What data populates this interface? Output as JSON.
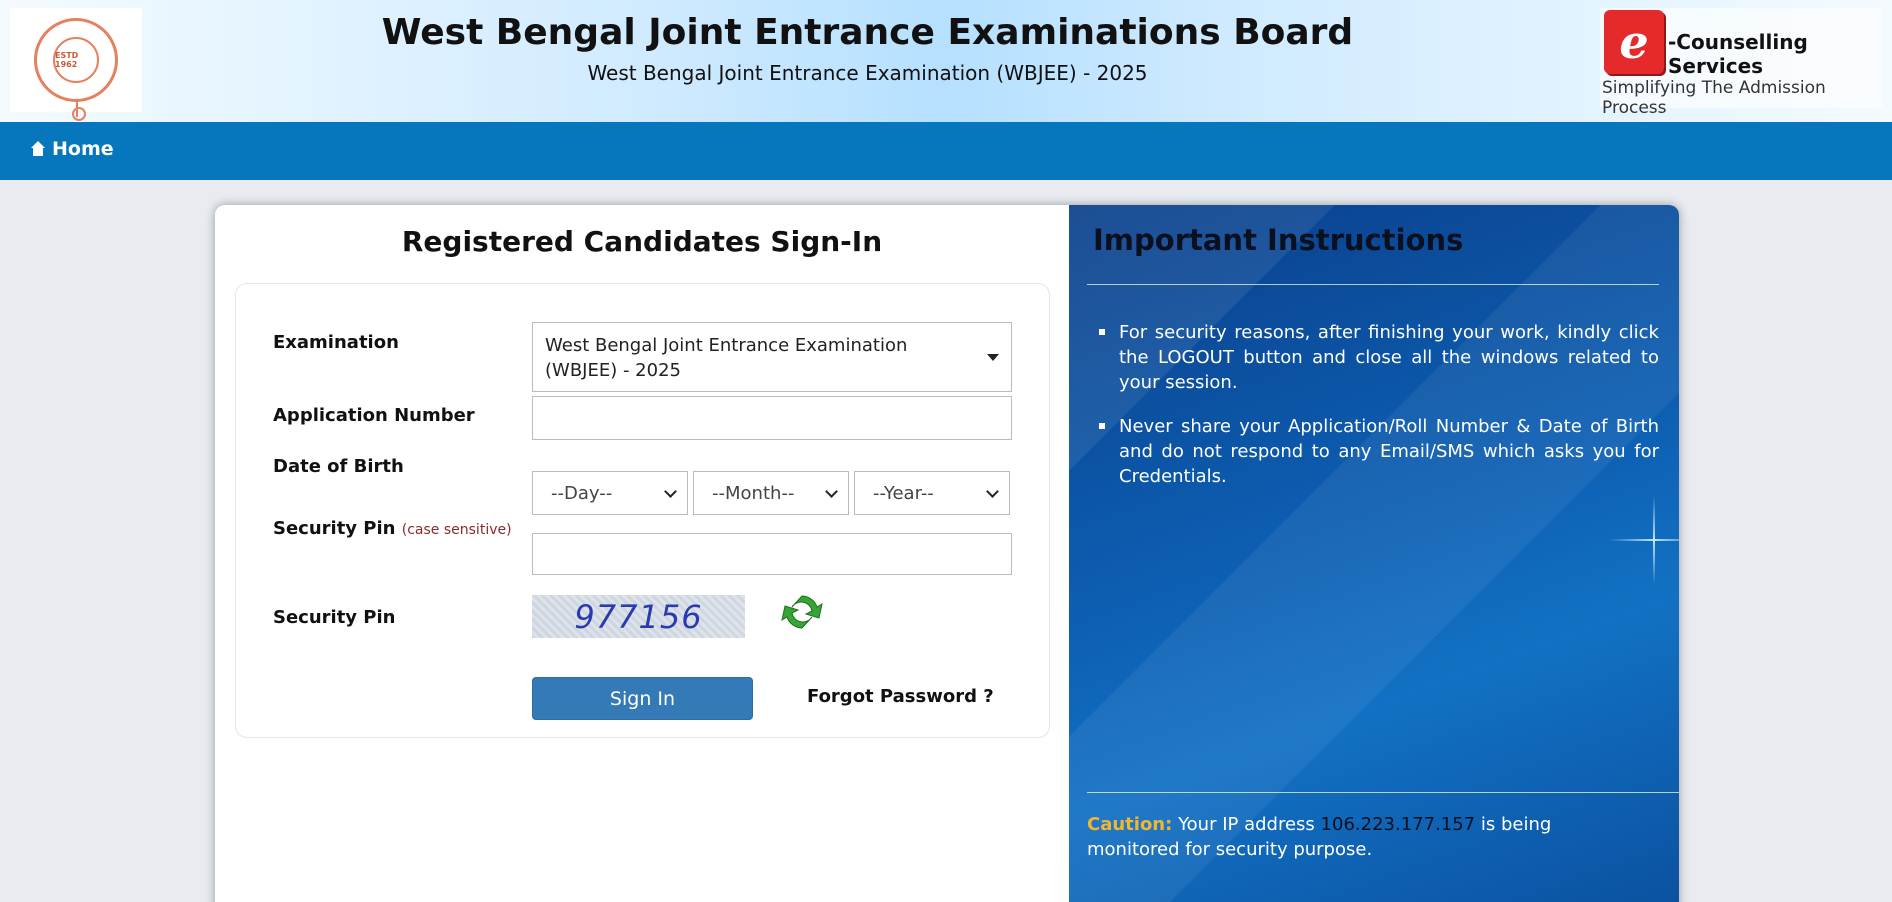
{
  "header": {
    "title": "West Bengal Joint Entrance Examinations Board",
    "subtitle": "West Bengal Joint Entrance Examination (WBJEE) - 2025",
    "logo_left_text": "ESTD 1962",
    "ec_logo_letter": "e",
    "ec_service": "-Counselling Services",
    "ec_tagline": "Simplifying The Admission Process"
  },
  "nav": {
    "home_label": "Home"
  },
  "signin": {
    "title": "Registered Candidates Sign-In",
    "examination_label": "Examination",
    "examination_value": "West Bengal Joint Entrance Examination (WBJEE) - 2025",
    "application_label": "Application Number",
    "application_value": "",
    "dob_label": "Date of Birth",
    "dob_day": "--Day--",
    "dob_month": "--Month--",
    "dob_year": "--Year--",
    "pin_label": "Security Pin",
    "pin_note": "(case sensitive)",
    "pin_value": "",
    "captcha_label": "Security Pin",
    "captcha_text": "977156",
    "signin_button": "Sign In",
    "forgot_link": "Forgot Password ?"
  },
  "instructions": {
    "title": "Important Instructions",
    "items": [
      "For security reasons, after finishing your work, kindly click the LOGOUT button and close all the windows related to your session.",
      "Never share your Application/Roll Number & Date of Birth and do not respond to any Email/SMS which asks you for Credentials."
    ],
    "caution_label": "Caution:",
    "caution_pre": "Your IP address",
    "ip_address": "106.223.177.157",
    "caution_post": "is being monitored for security purpose."
  },
  "colors": {
    "nav_bg": "#0676bd",
    "button_bg": "#337ab7",
    "caution": "#f2b531",
    "ec_red": "#e42a2a"
  }
}
